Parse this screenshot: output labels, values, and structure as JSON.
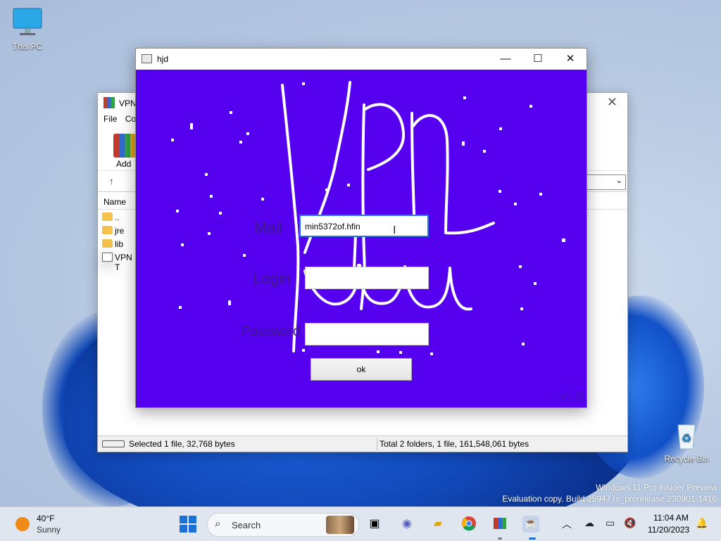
{
  "desktop": {
    "icons": [
      {
        "label": "This PC"
      },
      {
        "label": "Recycle Bin"
      }
    ],
    "watermark": {
      "line1": "Windows 11 Pro Insider Preview",
      "line2": "Evaluation copy. Build 25947.rs_prerelease.230901-1416"
    }
  },
  "winrar": {
    "title": "VPN",
    "menu": [
      "File",
      "Co"
    ],
    "toolbar": {
      "add_label": "Add"
    },
    "column_name": "Name",
    "files": [
      {
        "name": "..",
        "type": "folder"
      },
      {
        "name": "jre",
        "type": "folder"
      },
      {
        "name": "lib",
        "type": "folder"
      },
      {
        "name": "VPN T",
        "type": "app"
      }
    ],
    "status_left": "Selected 1 file, 32,768 bytes",
    "status_right": "Total 2 folders, 1 file, 161,548,061 bytes"
  },
  "app": {
    "title": "hjd",
    "labels": {
      "mail": "Mail",
      "login": "Login",
      "password": "Password"
    },
    "fields": {
      "mail_value": "min5372of.hfin",
      "login_value": "",
      "password_value": ""
    },
    "ok_label": "ok",
    "version": "v1.0",
    "canvas_color": "#5500ee"
  },
  "taskbar": {
    "weather": {
      "temp": "40°F",
      "condition": "Sunny"
    },
    "search_placeholder": "Search",
    "clock": {
      "time": "11:04 AM",
      "date": "11/20/2023"
    }
  }
}
